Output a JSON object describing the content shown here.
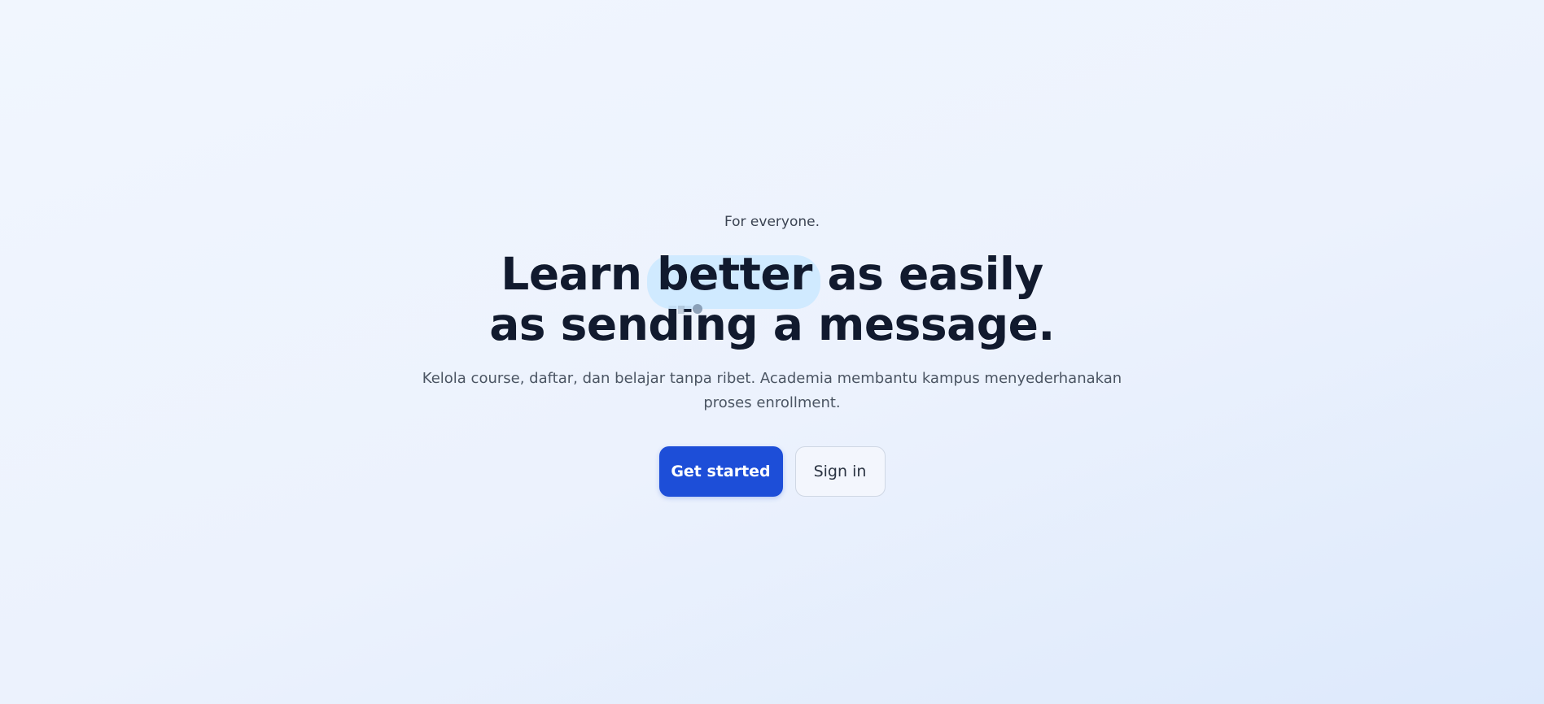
{
  "hero": {
    "eyebrow": "For everyone.",
    "headline": {
      "line1_before": "Learn ",
      "line1_highlight": "better",
      "line1_after": " as easily",
      "line2": "as sending a message."
    },
    "subtitle": "Kelola course, daftar, dan belajar tanpa ribet. Academia membantu kampus menyederhanakan proses enrollment."
  },
  "actions": {
    "primary_label": "Get started",
    "secondary_label": "Sign in"
  },
  "colors": {
    "primary": "#1d4ed8",
    "highlight": "#cfe9ff",
    "text": "#111a2e"
  }
}
